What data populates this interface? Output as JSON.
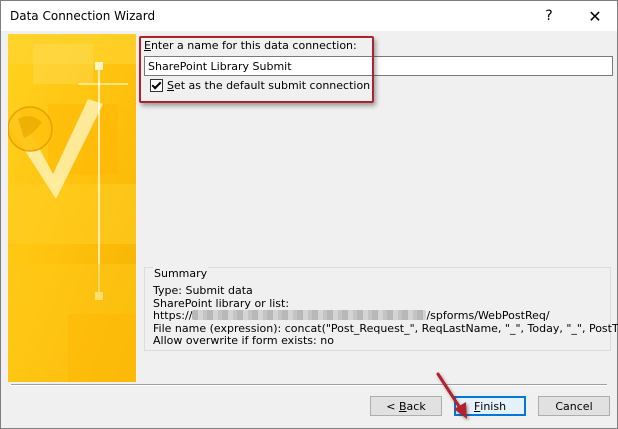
{
  "window": {
    "title": "Data Connection Wizard",
    "help_glyph": "?",
    "close_glyph": "✕"
  },
  "form": {
    "name_label_hotkey": "E",
    "name_label_rest": "nter a name for this data connection:",
    "name_value": "SharePoint Library Submit",
    "default_label_hotkey": "S",
    "default_label_rest": "et as the default submit connection",
    "default_checked": true
  },
  "summary": {
    "title": "Summary",
    "type_line": "Type: Submit data",
    "library_line": "SharePoint library or list:",
    "url_prefix": "https://",
    "url_suffix": "/spforms/WebPostReq/",
    "file_name_line": "File name (expression): concat(\"Post_Request_\", ReqLastName, \"_\", Today, \"_\", PostTitle)",
    "overwrite_line": "Allow overwrite if form exists: no"
  },
  "buttons": {
    "back_prefix": "< ",
    "back_hotkey": "B",
    "back_rest": "ack",
    "finish_hotkey": "F",
    "finish_rest": "inish",
    "cancel_label": "Cancel"
  },
  "colors": {
    "highlight": "#b0212e",
    "art_primary": "#ffc20e",
    "focus_border": "#0078d7"
  },
  "icons": [
    "help-icon",
    "close-icon",
    "checkmark-icon",
    "annotation-arrow-icon"
  ]
}
